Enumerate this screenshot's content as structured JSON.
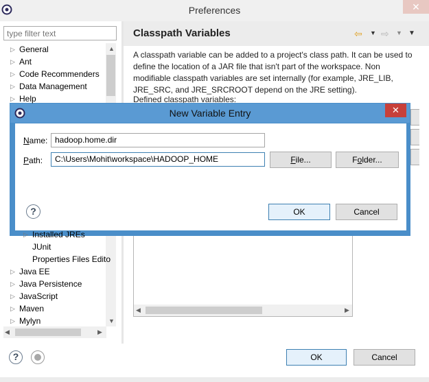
{
  "window": {
    "title": "Preferences",
    "close_glyph": "✕"
  },
  "filter": {
    "placeholder": "type filter text"
  },
  "tree": {
    "items_top": [
      {
        "label": "General",
        "expandable": true
      },
      {
        "label": "Ant",
        "expandable": true
      },
      {
        "label": "Code Recommenders",
        "expandable": true
      },
      {
        "label": "Data Management",
        "expandable": true
      },
      {
        "label": "Help",
        "expandable": true
      }
    ],
    "items_bottom": [
      {
        "label": "Installed JREs",
        "expandable": true,
        "indent": 1
      },
      {
        "label": "JUnit",
        "expandable": false,
        "indent": 1
      },
      {
        "label": "Properties Files Edito",
        "expandable": false,
        "indent": 1
      },
      {
        "label": "Java EE",
        "expandable": true,
        "indent": 0
      },
      {
        "label": "Java Persistence",
        "expandable": true,
        "indent": 0
      },
      {
        "label": "JavaScript",
        "expandable": true,
        "indent": 0
      },
      {
        "label": "Maven",
        "expandable": true,
        "indent": 0
      },
      {
        "label": "Mylyn",
        "expandable": true,
        "indent": 0
      }
    ]
  },
  "page": {
    "title": "Classpath Variables",
    "description": "A classpath variable can be added to a project's class path. It can be used to define the location of a JAR file that isn't part of the workspace. Non modifiable classpath variables are set internally (for example, JRE_LIB, JRE_SRC, and JRE_SRCROOT depend on the JRE setting).",
    "defined_label": "Defined classpath variables:"
  },
  "buttons": {
    "ok": "OK",
    "cancel": "Cancel",
    "help": "?"
  },
  "dialog": {
    "title": "New Variable Entry",
    "close_glyph": "✕",
    "name_label_u": "N",
    "name_label_rest": "ame:",
    "name_value": "hadoop.home.dir",
    "path_label_u": "P",
    "path_label_rest": "ath:",
    "path_value": "C:\\Users\\Mohit\\workspace\\HADOOP_HOME",
    "file_button_u": "F",
    "file_button_rest": "ile...",
    "folder_button_pre": "F",
    "folder_button_u": "o",
    "folder_button_rest": "lder...",
    "ok": "OK",
    "cancel": "Cancel",
    "help": "?"
  },
  "colors": {
    "dialog_border": "#4a8ec9",
    "dialog_close": "#c7403a",
    "default_button_border": "#3c7fb1"
  }
}
